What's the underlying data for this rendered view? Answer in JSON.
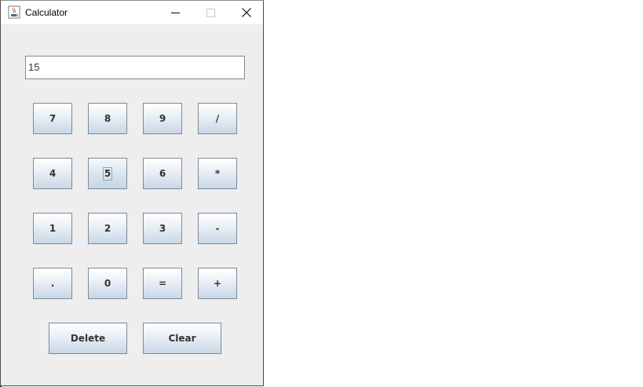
{
  "window": {
    "title": "Calculator",
    "icon": "java-coffee-cup-icon"
  },
  "display": {
    "value": "15"
  },
  "keypad": {
    "rows": [
      [
        "7",
        "8",
        "9",
        "/"
      ],
      [
        "4",
        "5",
        "6",
        "*"
      ],
      [
        "1",
        "2",
        "3",
        "-"
      ],
      [
        ".",
        "0",
        "=",
        "+"
      ]
    ],
    "focused_key": "5"
  },
  "actions": {
    "delete_label": "Delete",
    "clear_label": "Clear"
  },
  "colors": {
    "window_bg": "#eeeeee",
    "button_border": "#7a8a99",
    "button_gradient_bottom": "#c9d7e6"
  }
}
